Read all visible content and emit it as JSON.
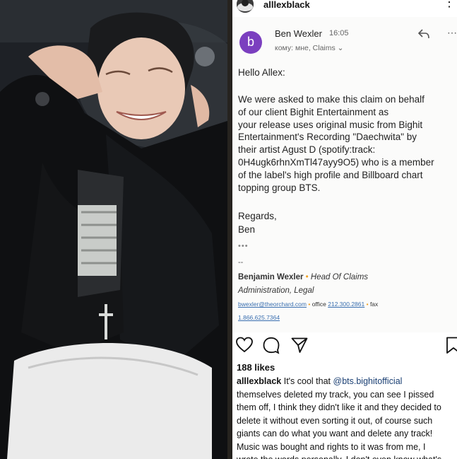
{
  "instagram": {
    "username": "alllexblack",
    "more_icon": "more-vertical-icon",
    "likes": "188 likes",
    "caption": {
      "username": "alllexblack",
      "lead": " It's cool that ",
      "mention": "@bts.bighitofficial",
      "rest": "\nthemselves deleted my track, you can see I pissed\nthem off, I think they didn't like it and they decided to\ndelete it without even sorting it out, of course such\ngiants can do what you want and delete any track!\nMusic was bought and rights to it was from me, I\nwrote the words personally, I don't even know what's"
    },
    "actions": [
      "heart-icon",
      "comment-icon",
      "share-icon",
      "bookmark-icon"
    ]
  },
  "email": {
    "sender_initial": "b",
    "sender_name": "Ben Wexler",
    "time": "16:05",
    "recipients": "кому: мне, Claims ⌄",
    "greeting": "Hello Allex:",
    "body": "We were asked to make this claim on behalf\nof our client Bighit Entertainment as\nyour release uses original music from Bighit\nEntertainment's Recording \"Daechwita\" by\ntheir artist Agust D (spotify:track:\n0H4ugk6rhnXmTl47ayy9O5) who is a member\nof the label's high profile and Billboard chart\ntopping group BTS.",
    "regards": "Regards,\nBen",
    "ellipsis": "•••",
    "signature": {
      "dashes": "--",
      "name": "Benjamin Wexler",
      "separator": " • ",
      "title_part1": "Head Of Claims",
      "title_part2": "Administration, Legal",
      "email": "bwexler@theorchard.com",
      "office_label": "office",
      "office_number": "212.300.2861",
      "fax_label": "fax",
      "fax_number": "1.866.625.7364"
    }
  },
  "colors": {
    "avatar_purple": "#7b3fbf",
    "link_blue": "#3a6fb0",
    "signature_dot": "#f0a020"
  }
}
